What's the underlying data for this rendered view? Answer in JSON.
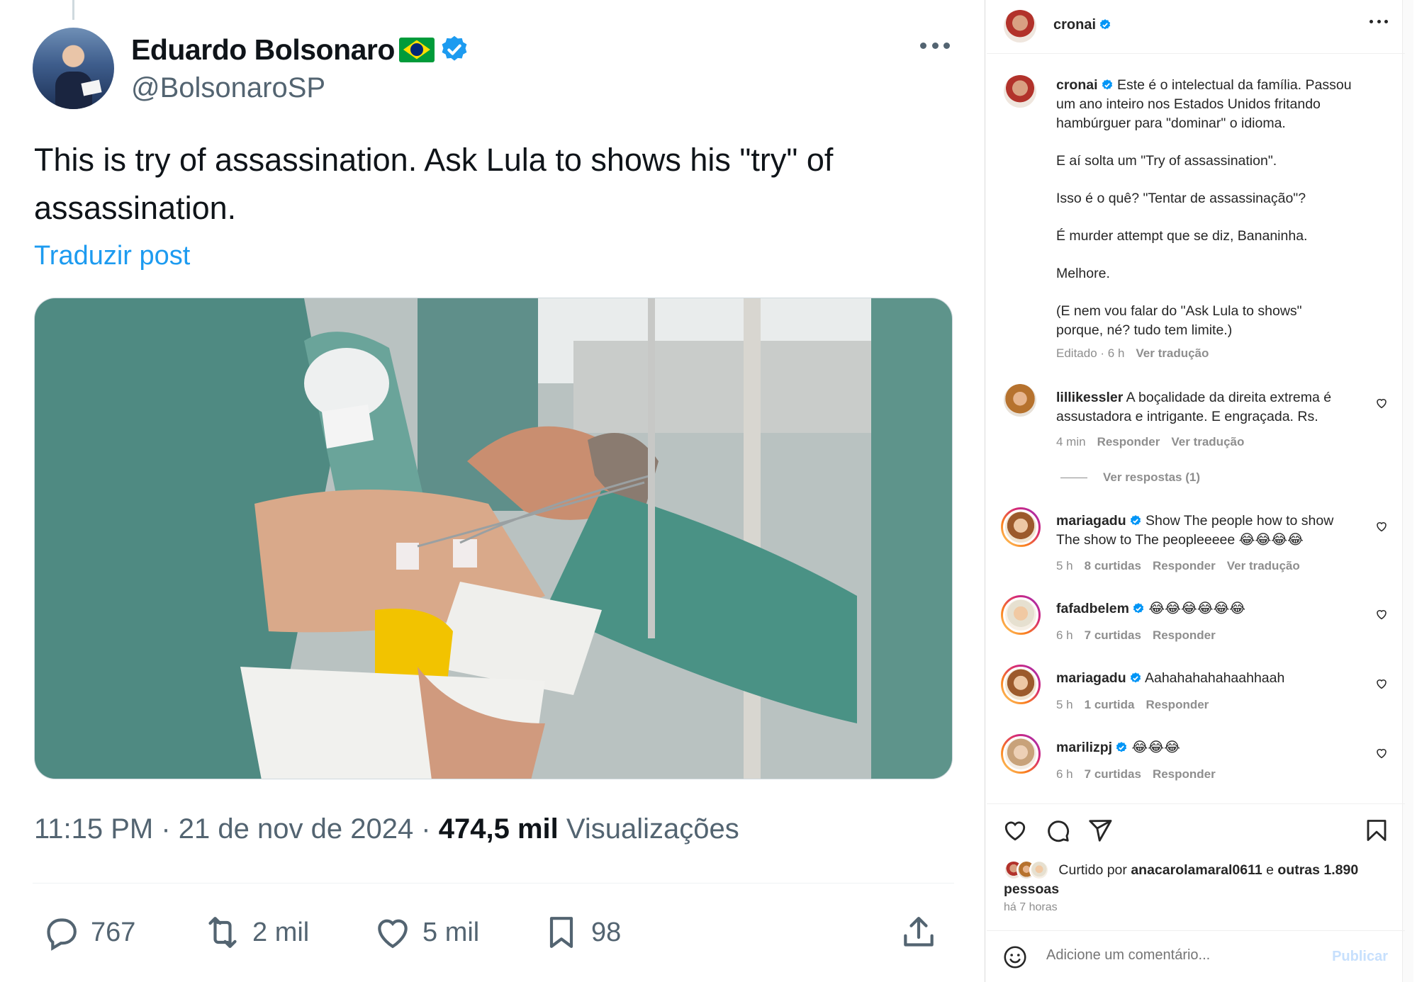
{
  "tweet": {
    "author_name": "Eduardo Bolsonaro",
    "handle": "@BolsonaroSP",
    "text": "This is try of assassination. Ask Lula to shows his \"try\" of assassination.",
    "translate_label": "Traduzir post",
    "time": "11:15 PM · 21 de nov de 2024 · ",
    "views_count": "474,5 mil",
    "views_label": " Visualizações",
    "actions": {
      "replies": "767",
      "retweets": "2 mil",
      "likes": "5 mil",
      "bookmarks": "98"
    }
  },
  "instagram": {
    "header_user": "cronai",
    "caption": {
      "user": "cronai",
      "lines": [
        "Este é o intelectual da família. Passou",
        "um ano inteiro nos Estados Unidos fritando",
        "hambúrguer para \"dominar\" o idioma.",
        "E aí solta um \"Try of assassination\".",
        "Isso é o quê? \"Tentar de assassinação\"?",
        "É murder attempt que se diz, Bananinha.",
        "Melhore.",
        "(E nem vou falar do \"Ask Lula to shows\"",
        "porque, né? tudo tem limite.)"
      ],
      "edited": "Editado · 6 h",
      "see_translation": "Ver tradução"
    },
    "comments": [
      {
        "user": "lillikessler",
        "verified": false,
        "text1": "A boçalidade da direita extrema é",
        "text2": "assustadora e intrigante. E engraçada. Rs.",
        "time": "4 min",
        "likes": "",
        "reply": "Responder",
        "translate": "Ver tradução"
      },
      {
        "user": "mariagadu",
        "verified": true,
        "text1": "Show The people how to show",
        "text2": "The show to The peopleeeee 😂😂😂😂",
        "time": "5 h",
        "likes": "8 curtidas",
        "reply": "Responder",
        "translate": "Ver tradução"
      },
      {
        "user": "fafadbelem",
        "verified": true,
        "text1": "😂😂😂😂😂😂",
        "text2": "",
        "time": "6 h",
        "likes": "7 curtidas",
        "reply": "Responder",
        "translate": ""
      },
      {
        "user": "mariagadu",
        "verified": true,
        "text1": "Aahahahahahaahhaah",
        "text2": "",
        "time": "5 h",
        "likes": "1 curtida",
        "reply": "Responder",
        "translate": ""
      },
      {
        "user": "marilizpj",
        "verified": true,
        "text1": "😂😂😂",
        "text2": "",
        "time": "6 h",
        "likes": "7 curtidas",
        "reply": "Responder",
        "translate": ""
      }
    ],
    "view_replies": "Ver respostas (1)",
    "liked_by_prefix": "Curtido por ",
    "liked_by_user": "anacarolamaral0611",
    "liked_by_mid": " e ",
    "liked_by_others": "outras 1.890 pessoas",
    "time_ago": "há 7 horas",
    "comment_placeholder": "Adicione um comentário...",
    "publish_label": "Publicar"
  },
  "colors": {
    "x_blue": "#1d9bf0",
    "x_gray": "#536471",
    "ig_verified": "#0095f6",
    "ig_gray": "#8e8e8e"
  }
}
